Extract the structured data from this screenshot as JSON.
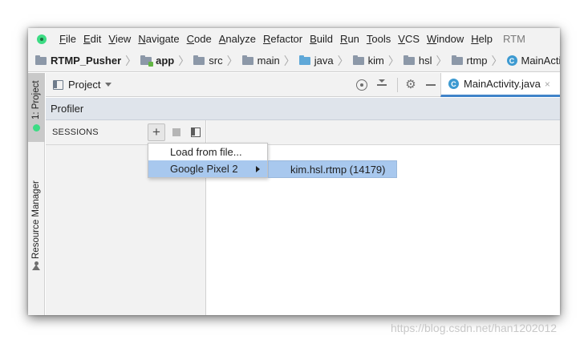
{
  "menubar": {
    "items": [
      "File",
      "Edit",
      "View",
      "Navigate",
      "Code",
      "Analyze",
      "Refactor",
      "Build",
      "Run",
      "Tools",
      "VCS",
      "Window",
      "Help"
    ],
    "title_fragment": "RTM"
  },
  "breadcrumb": {
    "items": [
      {
        "label": "RTMP_Pusher",
        "icon": "project-folder-icon"
      },
      {
        "label": "app",
        "icon": "module-folder-icon"
      },
      {
        "label": "src",
        "icon": "folder-icon"
      },
      {
        "label": "main",
        "icon": "folder-icon"
      },
      {
        "label": "java",
        "icon": "source-folder-icon"
      },
      {
        "label": "kim",
        "icon": "package-icon"
      },
      {
        "label": "hsl",
        "icon": "package-icon"
      },
      {
        "label": "rtmp",
        "icon": "package-icon"
      },
      {
        "label": "MainActivity",
        "icon": "class-icon"
      }
    ]
  },
  "left_strip": {
    "tabs": [
      "1: Project",
      "Resource Manager"
    ]
  },
  "project_header": {
    "label": "Project"
  },
  "editor_tab": {
    "label": "MainActivity.java",
    "class_glyph": "C",
    "close_glyph": "×"
  },
  "profiler": {
    "title": "Profiler",
    "sessions_label": "SESSIONS",
    "add_glyph": "+"
  },
  "popup_menu": {
    "items": [
      "Load from file...",
      "Google Pixel 2"
    ],
    "selected_index": 1
  },
  "submenu": {
    "items": [
      "kim.hsl.rtmp (14179)"
    ]
  },
  "watermark": "https://blog.csdn.net/han1202012",
  "colors": {
    "selection": "#a8c8ee",
    "profiler_bar": "#dfe4eb",
    "tab_underline": "#4083c9",
    "android_green": "#3ddc84"
  }
}
